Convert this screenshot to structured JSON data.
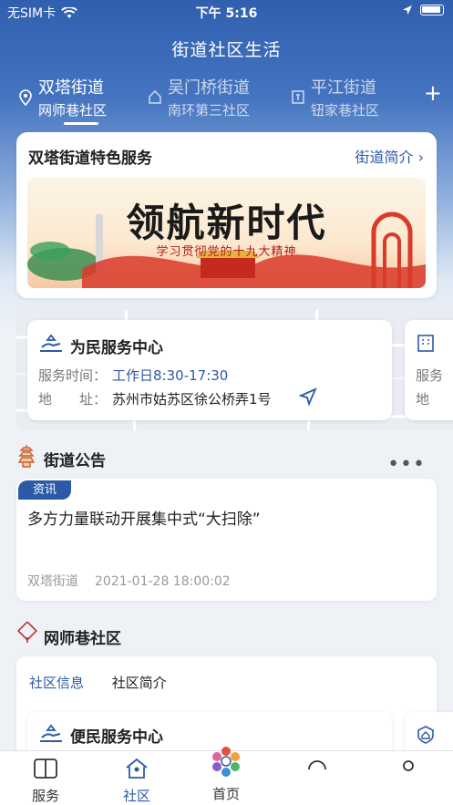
{
  "status": {
    "carrier": "无SIM卡",
    "time": "下午 5:16"
  },
  "header": {
    "title": "街道社区生活"
  },
  "streets": [
    {
      "name": "双塔街道",
      "community": "网师巷社区"
    },
    {
      "name": "吴门桥街道",
      "community": "南环第三社区"
    },
    {
      "name": "平江街道",
      "community": "钮家巷社区"
    }
  ],
  "feature": {
    "title": "双塔街道特色服务",
    "link": "街道简介",
    "banner_title": "领航新时代",
    "banner_sub": "学习贯彻党的十九大精神"
  },
  "service_center": {
    "title": "为民服务中心",
    "hours_label": "服务时间：",
    "hours_value": "工作日8:30-17:30",
    "addr_label": "地　　址：",
    "addr_value": "苏州市姑苏区徐公桥弄1号",
    "next_hours_label": "服务",
    "next_addr_label": "地"
  },
  "notices": {
    "section_title": "街道公告",
    "more": "•••",
    "badge": "资讯",
    "title": "多方力量联动开展集中式“大扫除”",
    "source": "双塔街道",
    "date": "2021-01-28 18:00:02"
  },
  "community": {
    "section_title": "网师巷社区",
    "tabs": [
      "社区信息",
      "社区简介"
    ],
    "service_title": "便民服务中心"
  },
  "tabbar": [
    {
      "label": "服务",
      "icon": "book-icon"
    },
    {
      "label": "社区",
      "icon": "community-icon"
    },
    {
      "label": "首页",
      "icon": "home-logo-icon"
    },
    {
      "label": "",
      "icon": "profile-icon"
    },
    {
      "label": "",
      "icon": "user-icon"
    }
  ],
  "colors": {
    "accent": "#2b5aa6",
    "header_blue": "#2f5fae"
  }
}
